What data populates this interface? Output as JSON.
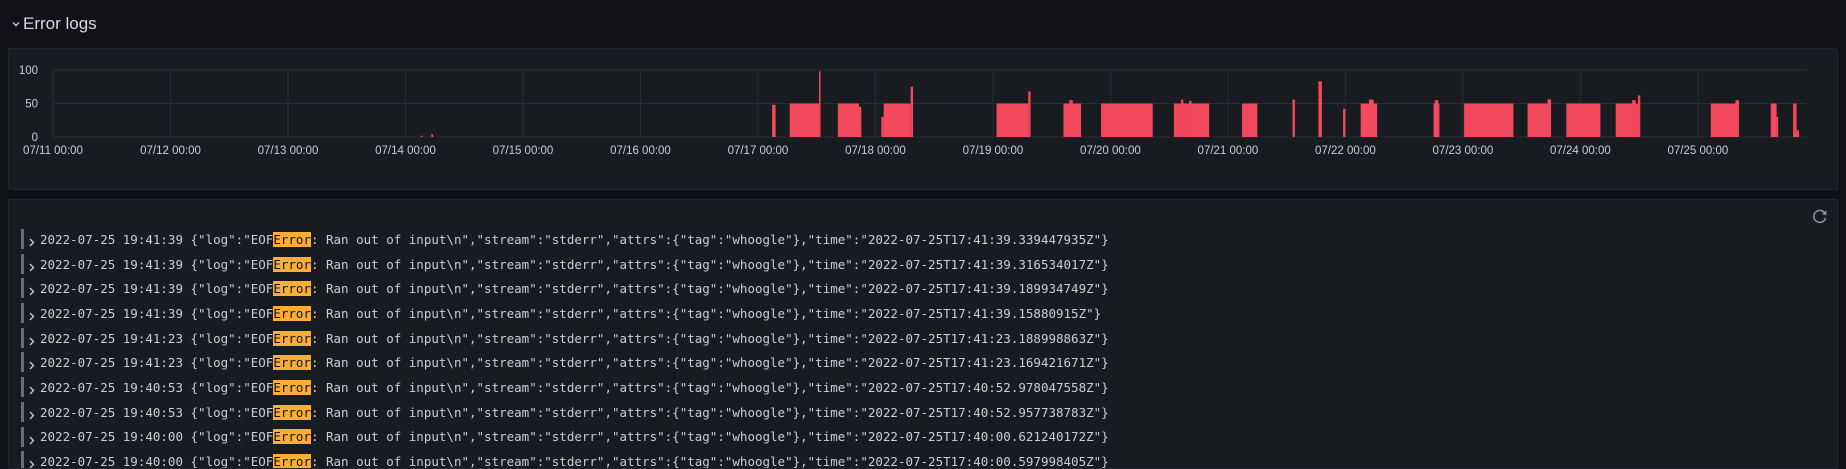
{
  "row": {
    "title": "Error logs"
  },
  "chart_data": {
    "type": "bar",
    "y_ticks": [
      "100",
      "50",
      "0"
    ],
    "ylim": [
      0,
      100
    ],
    "x_ticks": [
      "07/11 00:00",
      "07/12 00:00",
      "07/13 00:00",
      "07/14 00:00",
      "07/15 00:00",
      "07/16 00:00",
      "07/17 00:00",
      "07/18 00:00",
      "07/19 00:00",
      "07/20 00:00",
      "07/21 00:00",
      "07/22 00:00",
      "07/23 00:00",
      "07/24 00:00",
      "07/25 00:00"
    ],
    "x_day_range": [
      0,
      14.92
    ],
    "grid": true,
    "bar_color": "#f2495c",
    "bars": [
      {
        "d0": 3.13,
        "d1": 3.145,
        "v": 2
      },
      {
        "d0": 3.22,
        "d1": 3.235,
        "v": 4
      },
      {
        "d0": 6.12,
        "d1": 6.15,
        "v": 48
      },
      {
        "d0": 6.13,
        "d1": 6.15,
        "v": 28
      },
      {
        "d0": 6.27,
        "d1": 6.52,
        "v": 50
      },
      {
        "d0": 6.52,
        "d1": 6.53,
        "v": 98
      },
      {
        "d0": 6.68,
        "d1": 6.86,
        "v": 50
      },
      {
        "d0": 6.86,
        "d1": 6.88,
        "v": 45
      },
      {
        "d0": 7.05,
        "d1": 7.07,
        "v": 30
      },
      {
        "d0": 7.07,
        "d1": 7.3,
        "v": 50
      },
      {
        "d0": 7.3,
        "d1": 7.32,
        "v": 75
      },
      {
        "d0": 8.03,
        "d1": 8.3,
        "v": 50
      },
      {
        "d0": 8.3,
        "d1": 8.32,
        "v": 68
      },
      {
        "d0": 8.6,
        "d1": 8.75,
        "v": 50
      },
      {
        "d0": 8.65,
        "d1": 8.68,
        "v": 55
      },
      {
        "d0": 8.92,
        "d1": 9.36,
        "v": 50
      },
      {
        "d0": 9.54,
        "d1": 9.84,
        "v": 50
      },
      {
        "d0": 9.6,
        "d1": 9.62,
        "v": 56
      },
      {
        "d0": 9.67,
        "d1": 9.69,
        "v": 54
      },
      {
        "d0": 10.12,
        "d1": 10.25,
        "v": 50
      },
      {
        "d0": 10.55,
        "d1": 10.57,
        "v": 56
      },
      {
        "d0": 10.77,
        "d1": 10.8,
        "v": 83
      },
      {
        "d0": 10.98,
        "d1": 11.0,
        "v": 42
      },
      {
        "d0": 11.13,
        "d1": 11.27,
        "v": 50
      },
      {
        "d0": 11.2,
        "d1": 11.24,
        "v": 56
      },
      {
        "d0": 11.75,
        "d1": 11.8,
        "v": 50
      },
      {
        "d0": 11.76,
        "d1": 11.79,
        "v": 55
      },
      {
        "d0": 12.01,
        "d1": 12.43,
        "v": 50
      },
      {
        "d0": 12.55,
        "d1": 12.74,
        "v": 50
      },
      {
        "d0": 12.72,
        "d1": 12.75,
        "v": 56
      },
      {
        "d0": 12.88,
        "d1": 13.17,
        "v": 50
      },
      {
        "d0": 13.3,
        "d1": 13.5,
        "v": 50
      },
      {
        "d0": 13.44,
        "d1": 13.47,
        "v": 55
      },
      {
        "d0": 13.49,
        "d1": 13.51,
        "v": 62
      },
      {
        "d0": 14.11,
        "d1": 14.35,
        "v": 50
      },
      {
        "d0": 14.32,
        "d1": 14.35,
        "v": 55
      },
      {
        "d0": 14.62,
        "d1": 14.67,
        "v": 50
      },
      {
        "d0": 14.67,
        "d1": 14.68,
        "v": 30
      },
      {
        "d0": 14.81,
        "d1": 14.84,
        "v": 50
      },
      {
        "d0": 14.84,
        "d1": 14.86,
        "v": 10
      }
    ]
  },
  "logs": {
    "highlight_color": "#fbad37",
    "lines": [
      {
        "ts": "2022-07-25 19:41:39",
        "pre": " {\"log\":\"EOF",
        "hl": "Error",
        "post": ": Ran out of input\\n\",\"stream\":\"stderr\",\"attrs\":{\"tag\":\"whoogle\"},\"time\":\"2022-07-25T17:41:39.339447935Z\"}"
      },
      {
        "ts": "2022-07-25 19:41:39",
        "pre": " {\"log\":\"EOF",
        "hl": "Error",
        "post": ": Ran out of input\\n\",\"stream\":\"stderr\",\"attrs\":{\"tag\":\"whoogle\"},\"time\":\"2022-07-25T17:41:39.316534017Z\"}"
      },
      {
        "ts": "2022-07-25 19:41:39",
        "pre": " {\"log\":\"EOF",
        "hl": "Error",
        "post": ": Ran out of input\\n\",\"stream\":\"stderr\",\"attrs\":{\"tag\":\"whoogle\"},\"time\":\"2022-07-25T17:41:39.189934749Z\"}"
      },
      {
        "ts": "2022-07-25 19:41:39",
        "pre": " {\"log\":\"EOF",
        "hl": "Error",
        "post": ": Ran out of input\\n\",\"stream\":\"stderr\",\"attrs\":{\"tag\":\"whoogle\"},\"time\":\"2022-07-25T17:41:39.15880915Z\"}"
      },
      {
        "ts": "2022-07-25 19:41:23",
        "pre": " {\"log\":\"EOF",
        "hl": "Error",
        "post": ": Ran out of input\\n\",\"stream\":\"stderr\",\"attrs\":{\"tag\":\"whoogle\"},\"time\":\"2022-07-25T17:41:23.188998863Z\"}"
      },
      {
        "ts": "2022-07-25 19:41:23",
        "pre": " {\"log\":\"EOF",
        "hl": "Error",
        "post": ": Ran out of input\\n\",\"stream\":\"stderr\",\"attrs\":{\"tag\":\"whoogle\"},\"time\":\"2022-07-25T17:41:23.169421671Z\"}"
      },
      {
        "ts": "2022-07-25 19:40:53",
        "pre": " {\"log\":\"EOF",
        "hl": "Error",
        "post": ": Ran out of input\\n\",\"stream\":\"stderr\",\"attrs\":{\"tag\":\"whoogle\"},\"time\":\"2022-07-25T17:40:52.978047558Z\"}"
      },
      {
        "ts": "2022-07-25 19:40:53",
        "pre": " {\"log\":\"EOF",
        "hl": "Error",
        "post": ": Ran out of input\\n\",\"stream\":\"stderr\",\"attrs\":{\"tag\":\"whoogle\"},\"time\":\"2022-07-25T17:40:52.957738783Z\"}"
      },
      {
        "ts": "2022-07-25 19:40:00",
        "pre": " {\"log\":\"EOF",
        "hl": "Error",
        "post": ": Ran out of input\\n\",\"stream\":\"stderr\",\"attrs\":{\"tag\":\"whoogle\"},\"time\":\"2022-07-25T17:40:00.621240172Z\"}"
      },
      {
        "ts": "2022-07-25 19:40:00",
        "pre": " {\"log\":\"EOF",
        "hl": "Error",
        "post": ": Ran out of input\\n\",\"stream\":\"stderr\",\"attrs\":{\"tag\":\"whoogle\"},\"time\":\"2022-07-25T17:40:00.597998405Z\"}"
      }
    ]
  }
}
